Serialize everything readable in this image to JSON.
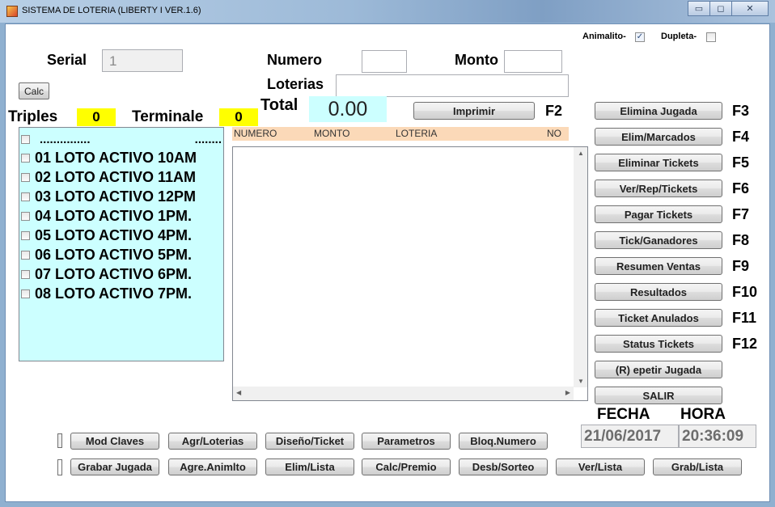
{
  "window": {
    "title": "SISTEMA DE LOTERIA (LIBERTY I VER.1.6)",
    "buttons": {
      "minimize": "▭",
      "maximize": "◻",
      "close": "✕"
    }
  },
  "header": {
    "animalito_label": "Animalito-",
    "animalito_checked": true,
    "dupleta_label": "Dupleta-",
    "dupleta_checked": false,
    "serial_label": "Serial",
    "serial_value": "1",
    "numero_label": "Numero",
    "monto_label": "Monto",
    "loterias_label": "Loterias",
    "calc_button": "Calc",
    "triples_label": "Triples",
    "triples_value": "0",
    "terminale_label": "Terminale",
    "terminale_value": "0",
    "total_label": "Total",
    "total_value": "0.00",
    "imprimir_button": "Imprimir",
    "imprimir_key": "F2"
  },
  "lotteries": {
    "header_left": "...............",
    "header_right": "........",
    "items": [
      {
        "label": "01 LOTO ACTIVO 10AM"
      },
      {
        "label": "02 LOTO ACTIVO 11AM"
      },
      {
        "label": "03 LOTO ACTIVO 12PM"
      },
      {
        "label": "04 LOTO ACTIVO 1PM."
      },
      {
        "label": "05 LOTO ACTIVO 4PM."
      },
      {
        "label": "06 LOTO ACTIVO 5PM."
      },
      {
        "label": "07 LOTO ACTIVO 6PM."
      },
      {
        "label": "08 LOTO ACTIVO 7PM."
      }
    ]
  },
  "grid": {
    "columns": [
      "NUMERO",
      "MONTO",
      "LOTERIA",
      "NO"
    ]
  },
  "actions": [
    {
      "label": "Elimina Jugada",
      "key": "F3"
    },
    {
      "label": "Elim/Marcados",
      "key": "F4"
    },
    {
      "label": "Eliminar Tickets",
      "key": "F5"
    },
    {
      "label": "Ver/Rep/Tickets",
      "key": "F6"
    },
    {
      "label": "Pagar Tickets",
      "key": "F7"
    },
    {
      "label": "Tick/Ganadores",
      "key": "F8"
    },
    {
      "label": "Resumen Ventas",
      "key": "F9"
    },
    {
      "label": "Resultados",
      "key": "F10"
    },
    {
      "label": "Ticket Anulados",
      "key": "F11"
    },
    {
      "label": "Status Tickets",
      "key": "F12"
    },
    {
      "label": "(R) epetir Jugada",
      "key": ""
    },
    {
      "label": "SALIR",
      "key": ""
    }
  ],
  "datetime": {
    "fecha_label": "FECHA",
    "fecha_value": "21/06/2017",
    "hora_label": "HORA",
    "hora_value": "20:36:09"
  },
  "bottom_row1": [
    "Mod Claves",
    "Agr/Loterias",
    "Diseño/Ticket",
    "Parametros",
    "Bloq.Numero"
  ],
  "bottom_row2": [
    "Grabar Jugada",
    "Agre.Animlto",
    "Elim/Lista",
    "Calc/Premio",
    "Desb/Sorteo",
    "Ver/Lista",
    "Grab/Lista"
  ],
  "colors": {
    "lottery_panel": "#ccffff",
    "counter_bg": "#ffff00",
    "total_bg": "#ccffff",
    "grid_header": "#fbd9b8"
  }
}
